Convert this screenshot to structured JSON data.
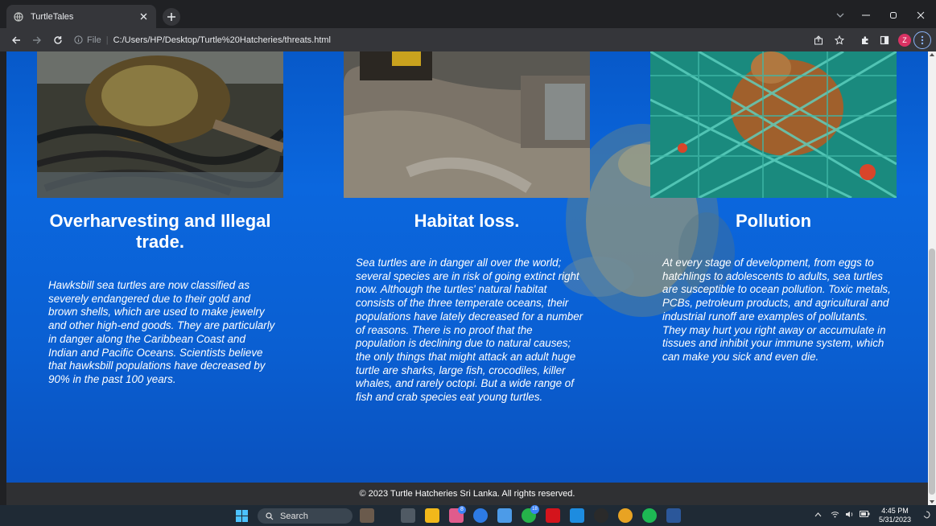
{
  "browser": {
    "tab_title": "TurtleTales",
    "tab_close": "×",
    "new_tab": "+",
    "window_controls": {
      "minimize": "−",
      "maximize": "▢",
      "close": "✕",
      "tab_search": "⌄"
    },
    "omnibox": {
      "scheme_label": "File",
      "separator": "|",
      "url": "C:/Users/HP/Desktop/Turtle%20Hatcheries/threats.html"
    },
    "profile_initial": "Z",
    "menu_icon": "⋮",
    "icons": [
      "back-icon",
      "forward-icon",
      "reload-icon",
      "info-icon",
      "share-icon",
      "bookmark-star-icon",
      "extensions-icon",
      "sidepanel-icon"
    ]
  },
  "page": {
    "cards": [
      {
        "title": "Overharvesting and Illegal trade.",
        "text": "Hawksbill sea turtles are now classified as severely endangered due to their gold and brown shells, which are used to make jewelry and other high-end goods. They are particularly in danger along the Caribbean Coast and Indian and Pacific Oceans. Scientists believe that hawksbill populations have decreased by 90% in the past 100 years."
      },
      {
        "title": "Habitat loss.",
        "text": "Sea turtles are in danger all over the world; several species are in risk of going extinct right now. Although the turtles' natural habitat consists of the three temperate oceans, their populations have lately decreased for a number of reasons. There is no proof that the population is declining due to natural causes; the only things that might attack an adult huge turtle are sharks, large fish, crocodiles, killer whales, and rarely octopi. But a wide range of fish and crab species eat young turtles."
      },
      {
        "title": "Pollution",
        "text": "At every stage of development, from eggs to hatchlings to adolescents to adults, sea turtles are susceptible to ocean pollution. Toxic metals, PCBs, petroleum products, and agricultural and industrial runoff are examples of pollutants. They may hurt you right away or accumulate in tissues and inhibit your immune system, which can make you sick and even die."
      }
    ],
    "footer": "© 2023 Turtle Hatcheries Sri Lanka. All rights reserved.",
    "colors": {
      "background": "#0a5fd2",
      "footer": "#2f3033",
      "text": "#ffffff"
    }
  },
  "taskbar": {
    "search_label": "Search",
    "clock_time": "4:45 PM",
    "clock_date": "5/31/2023",
    "tray_icons": [
      "chevron-up-icon",
      "wifi-icon",
      "volume-icon",
      "battery-icon",
      "notification-icon"
    ],
    "badge_teams": "8",
    "badge_whatsapp": "18"
  }
}
